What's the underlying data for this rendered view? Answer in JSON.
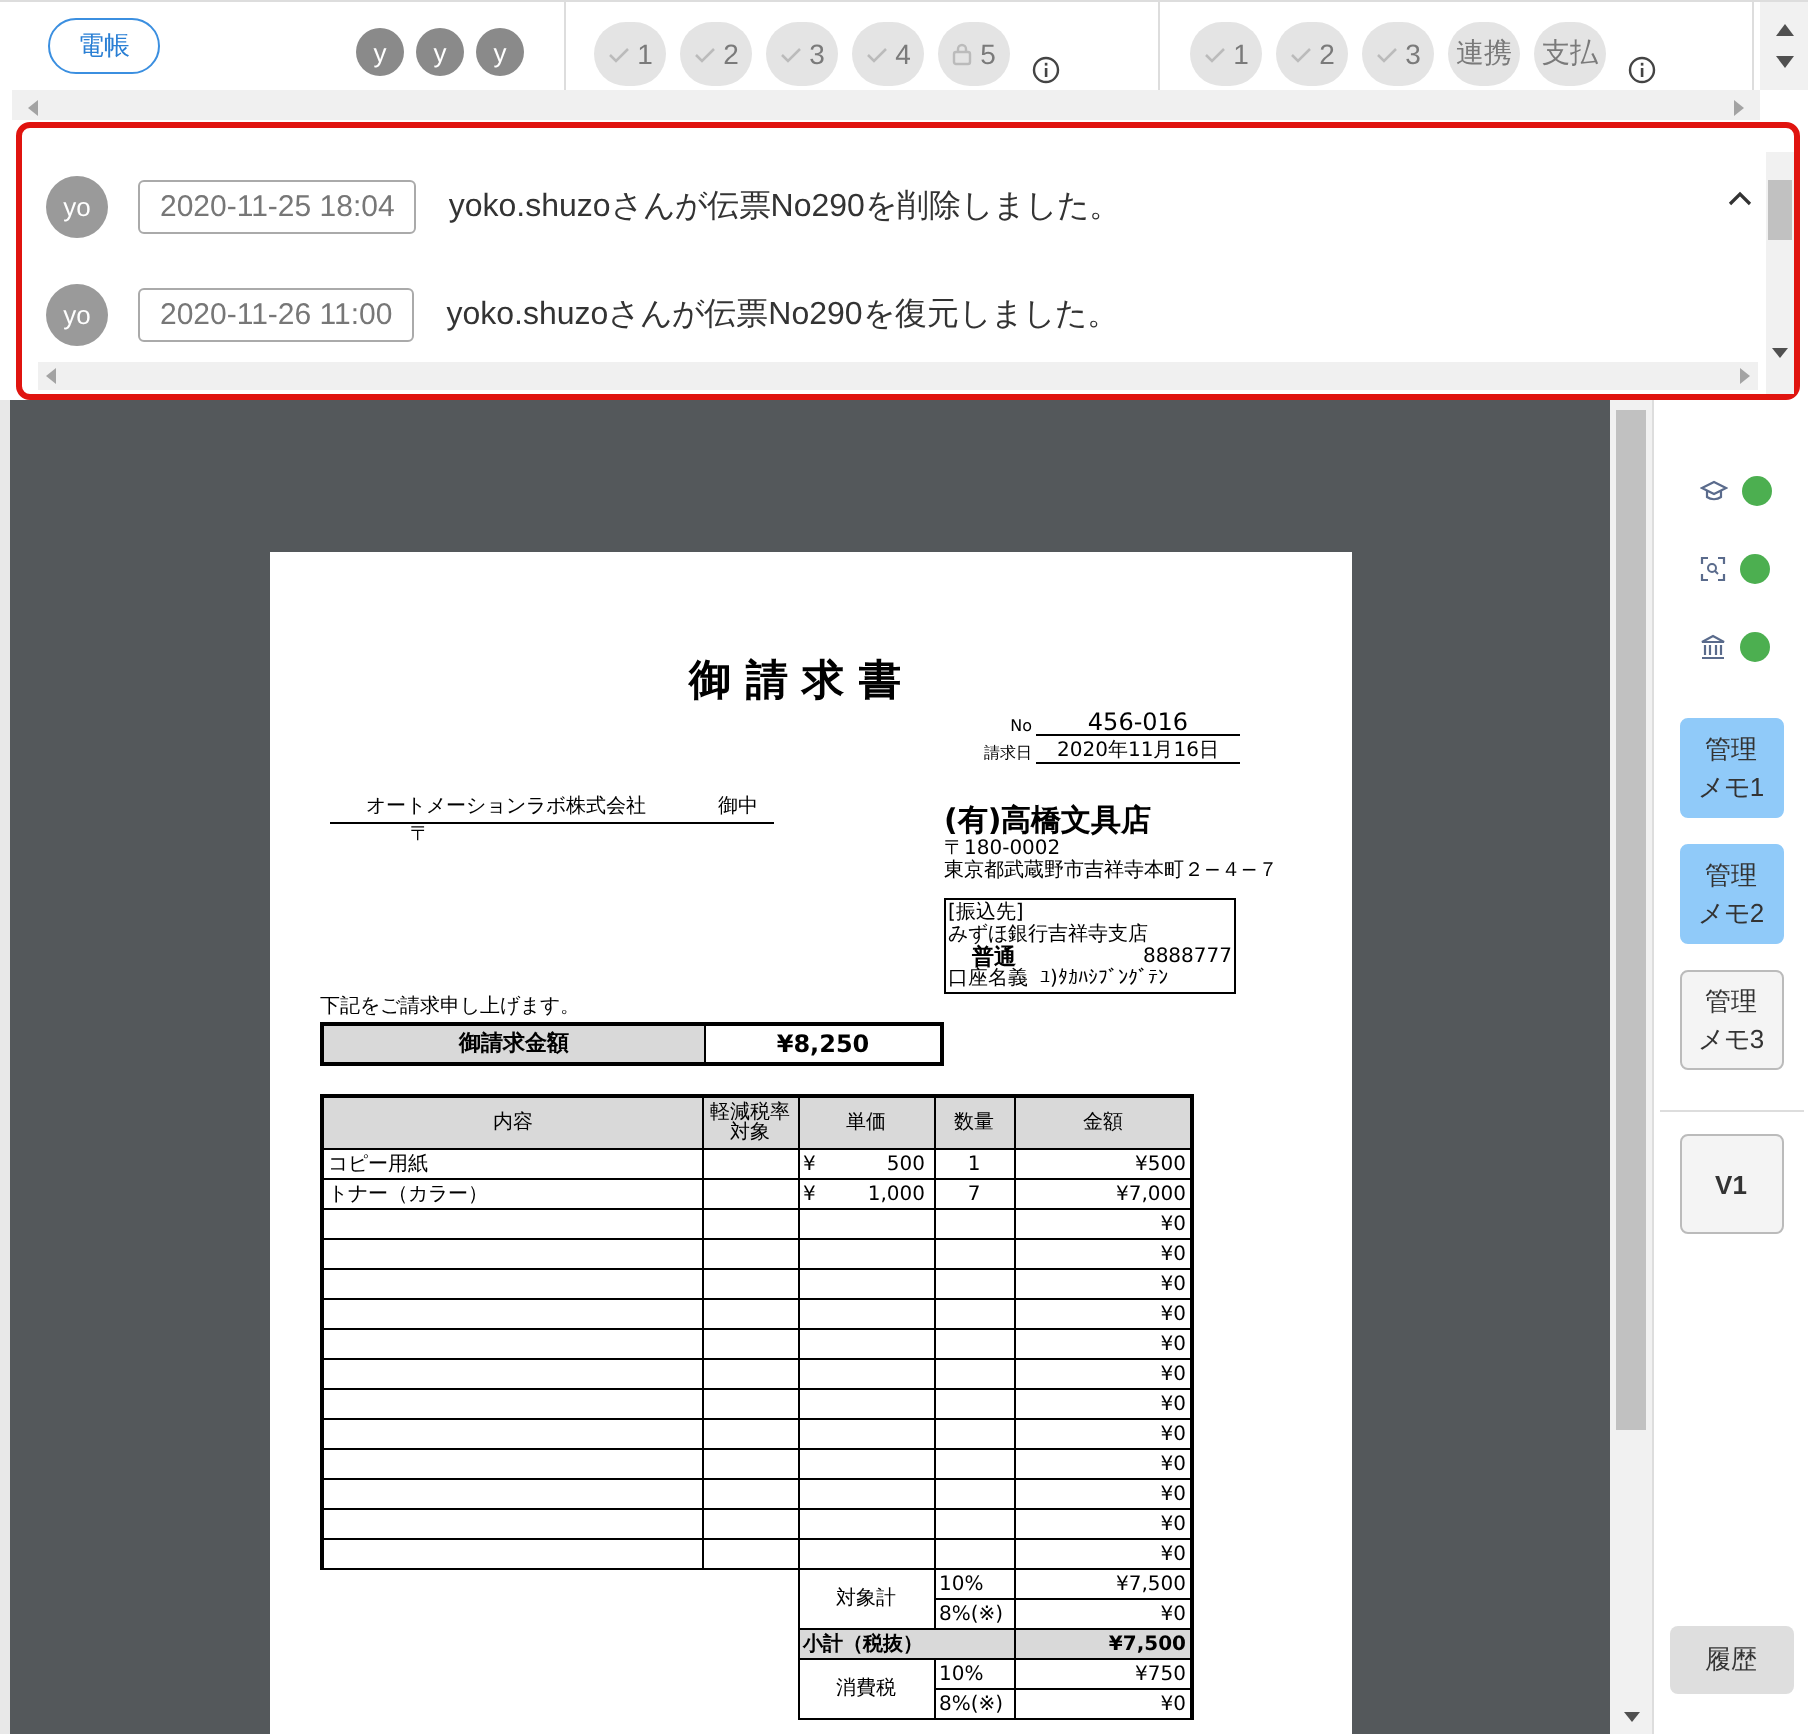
{
  "header": {
    "stamp_button": "電帳",
    "avatars": [
      "y",
      "y",
      "y"
    ],
    "step_groups": [
      {
        "steps": [
          {
            "kind": "check",
            "label": "1"
          },
          {
            "kind": "check",
            "label": "2"
          },
          {
            "kind": "check",
            "label": "3"
          },
          {
            "kind": "check",
            "label": "4"
          },
          {
            "kind": "lock",
            "label": "5"
          }
        ]
      },
      {
        "steps": [
          {
            "kind": "check",
            "label": "1"
          },
          {
            "kind": "check",
            "label": "2"
          },
          {
            "kind": "check",
            "label": "3"
          },
          {
            "kind": "text",
            "label": "連携"
          },
          {
            "kind": "text",
            "label": "支払"
          }
        ]
      }
    ]
  },
  "log": {
    "entries": [
      {
        "avatar": "yo",
        "time": "2020-11-25 18:04",
        "message": "yoko.shuzoさんが伝票No290を削除しました。"
      },
      {
        "avatar": "yo",
        "time": "2020-11-26 11:00",
        "message": "yoko.shuzoさんが伝票No290を復元しました。"
      }
    ]
  },
  "invoice": {
    "title": "御 請 求 書",
    "no_label": "No",
    "number": "456-016",
    "date_label": "請求日",
    "date": "2020年11月16日",
    "recipient": "オートメーションラボ株式会社",
    "honorific": "御中",
    "recipient_postal": "〒",
    "issuer": "(有)高橋文具店",
    "issuer_postal": "〒180-0002",
    "issuer_address": "東京都武蔵野市吉祥寺本町２−４−７",
    "bank": {
      "label": "[振込先]",
      "branch": "みずほ銀行吉祥寺支店",
      "account_type": "普通",
      "account_number": "8888777",
      "holder_label": "口座名義",
      "holder": "ﾕ)ﾀｶﾊｼﾌﾞﾝｸﾞﾃﾝ"
    },
    "intro": "下記をご請求申し上げます。",
    "total_label": "御請求金額",
    "total": "¥8,250",
    "columns": [
      "内容",
      "軽減税率対象",
      "単価",
      "数量",
      "金額"
    ],
    "rows": [
      {
        "item": "コピー用紙",
        "currency": "¥",
        "price": "500",
        "qty": "1",
        "amount": "¥500"
      },
      {
        "item": "トナー（カラー）",
        "currency": "¥",
        "price": "1,000",
        "qty": "7",
        "amount": "¥7,000"
      },
      {
        "amount": "¥0"
      },
      {
        "amount": "¥0"
      },
      {
        "amount": "¥0"
      },
      {
        "amount": "¥0"
      },
      {
        "amount": "¥0"
      },
      {
        "amount": "¥0"
      },
      {
        "amount": "¥0"
      },
      {
        "amount": "¥0"
      },
      {
        "amount": "¥0"
      },
      {
        "amount": "¥0"
      },
      {
        "amount": "¥0"
      },
      {
        "amount": "¥0"
      }
    ],
    "target_label": "対象計",
    "target": [
      {
        "rate": "10%",
        "amount": "¥7,500"
      },
      {
        "rate": "8%(※)",
        "amount": "¥0"
      }
    ],
    "subtotal_label": "小計（税抜）",
    "subtotal": "¥7,500",
    "tax_label": "消費税",
    "tax": [
      {
        "rate": "10%",
        "amount": "¥750"
      },
      {
        "rate": "8%(※)",
        "amount": "¥0"
      }
    ]
  },
  "sidebar": {
    "indicators": [
      {
        "kind": "education",
        "color": "#4caf50"
      },
      {
        "kind": "scan",
        "color": "#4caf50"
      },
      {
        "kind": "bank",
        "color": "#4caf50"
      }
    ],
    "memos": [
      {
        "label": "管理メモ1",
        "selected": true
      },
      {
        "label": "管理メモ2",
        "selected": true
      },
      {
        "label": "管理メモ3",
        "selected": false
      }
    ],
    "version_button": "V1",
    "history_button": "履歴"
  }
}
